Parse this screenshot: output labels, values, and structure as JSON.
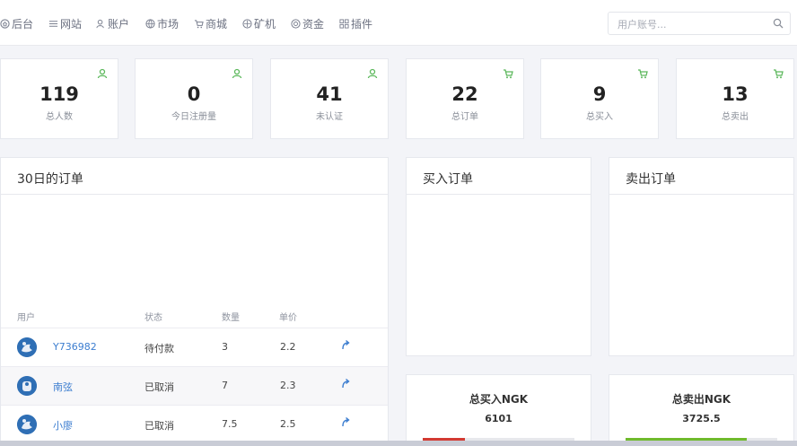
{
  "nav": {
    "items": [
      {
        "label": "后台",
        "icon": "home-icon"
      },
      {
        "label": "网站",
        "icon": "list-icon"
      },
      {
        "label": "账户",
        "icon": "user-icon"
      },
      {
        "label": "市场",
        "icon": "globe-icon"
      },
      {
        "label": "商城",
        "icon": "cart-icon"
      },
      {
        "label": "矿机",
        "icon": "target-icon"
      },
      {
        "label": "资金",
        "icon": "coin-icon"
      },
      {
        "label": "插件",
        "icon": "grid-icon"
      }
    ],
    "search_placeholder": "用户账号..."
  },
  "stats": [
    {
      "value": "119",
      "label": "总人数",
      "icon": "user-icon"
    },
    {
      "value": "0",
      "label": "今日注册量",
      "icon": "user-icon"
    },
    {
      "value": "41",
      "label": "未认证",
      "icon": "user-icon"
    },
    {
      "value": "22",
      "label": "总订单",
      "icon": "cart-icon"
    },
    {
      "value": "9",
      "label": "总买入",
      "icon": "cart-icon"
    },
    {
      "value": "13",
      "label": "总卖出",
      "icon": "cart-icon"
    }
  ],
  "orders_panel": {
    "title": "30日的订单",
    "columns": [
      "用户",
      "状态",
      "数量",
      "单价"
    ],
    "rows": [
      {
        "user": "Y736982",
        "status": "待付款",
        "qty": "3",
        "price": "2.2"
      },
      {
        "user": "南弦",
        "status": "已取消",
        "qty": "7",
        "price": "2.3"
      },
      {
        "user": "小廖",
        "status": "已取消",
        "qty": "7.5",
        "price": "2.5"
      }
    ]
  },
  "buy_panel": {
    "title": "买入订单"
  },
  "sell_panel": {
    "title": "卖出订单"
  },
  "totals": {
    "buy": {
      "title": "总买入NGK",
      "value": "6101",
      "fill": 0.28,
      "color": "#d33a32"
    },
    "sell": {
      "title": "总卖出NGK",
      "value": "3725.5",
      "fill": 0.8,
      "color": "#6fba2c"
    }
  },
  "colors": {
    "accent_green": "#5cb85c",
    "link_blue": "#3d7ed0"
  }
}
